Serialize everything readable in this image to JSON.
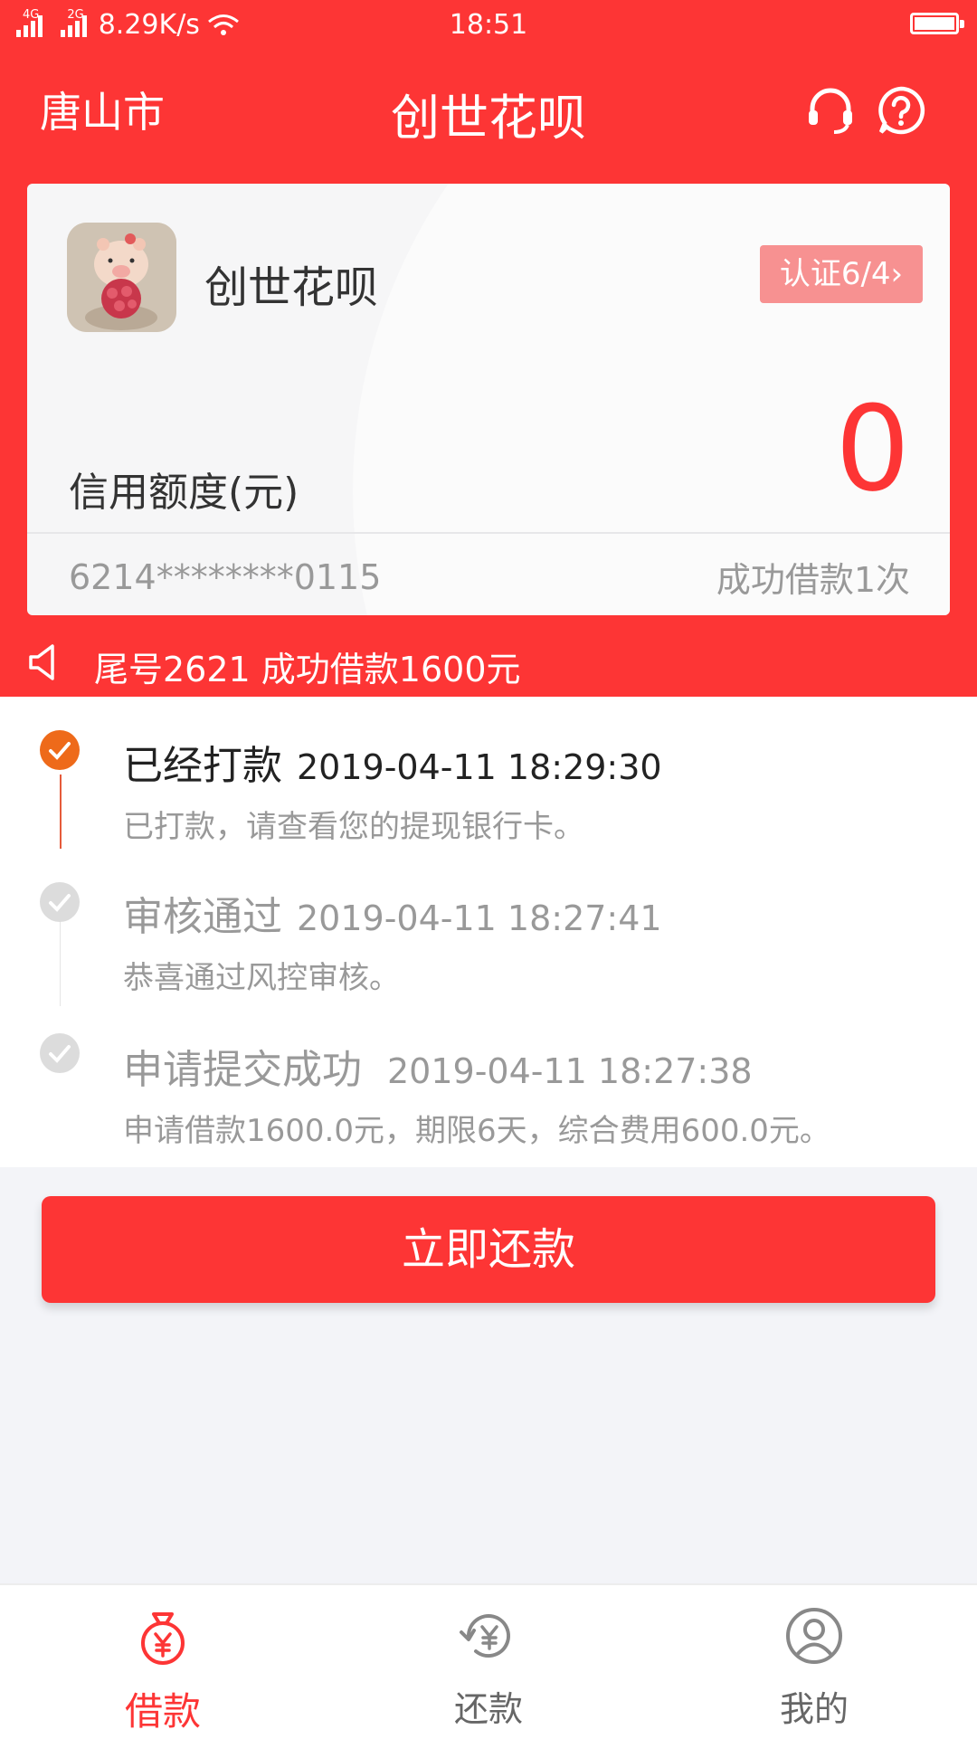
{
  "status_bar": {
    "network_4g": "4G",
    "network_2g": "2G",
    "speed": "8.29K/s",
    "time": "18:51"
  },
  "header": {
    "city": "唐山市",
    "title": "创世花呗"
  },
  "card": {
    "app_name": "创世花呗",
    "verify_label": "认证6/4",
    "credit_label": "信用额度(元)",
    "credit_amount": "0",
    "card_number": "6214********0115",
    "loan_count": "成功借款1次"
  },
  "notice": {
    "text": "尾号2621 成功借款1600元"
  },
  "timeline": [
    {
      "title": "已经打款",
      "time": "2019-04-11 18:29:30",
      "desc": "已打款，请查看您的提现银行卡。",
      "active": true
    },
    {
      "title": "审核通过",
      "time": "2019-04-11 18:27:41",
      "desc": "恭喜通过风控审核。",
      "active": false
    },
    {
      "title": "申请提交成功",
      "time": "2019-04-11 18:27:38",
      "desc": "申请借款1600.0元，期限6天，综合费用600.0元。",
      "active": false
    }
  ],
  "repay_button": "立即还款",
  "tabs": [
    {
      "label": "借款",
      "icon": "money-bag-icon",
      "active": true
    },
    {
      "label": "还款",
      "icon": "repay-cycle-icon",
      "active": false
    },
    {
      "label": "我的",
      "icon": "user-icon",
      "active": false
    }
  ],
  "colors": {
    "brand_red": "#fd3535",
    "badge_pink": "#f79191",
    "active_step": "#ee6a1a",
    "inactive_text": "#999999"
  }
}
